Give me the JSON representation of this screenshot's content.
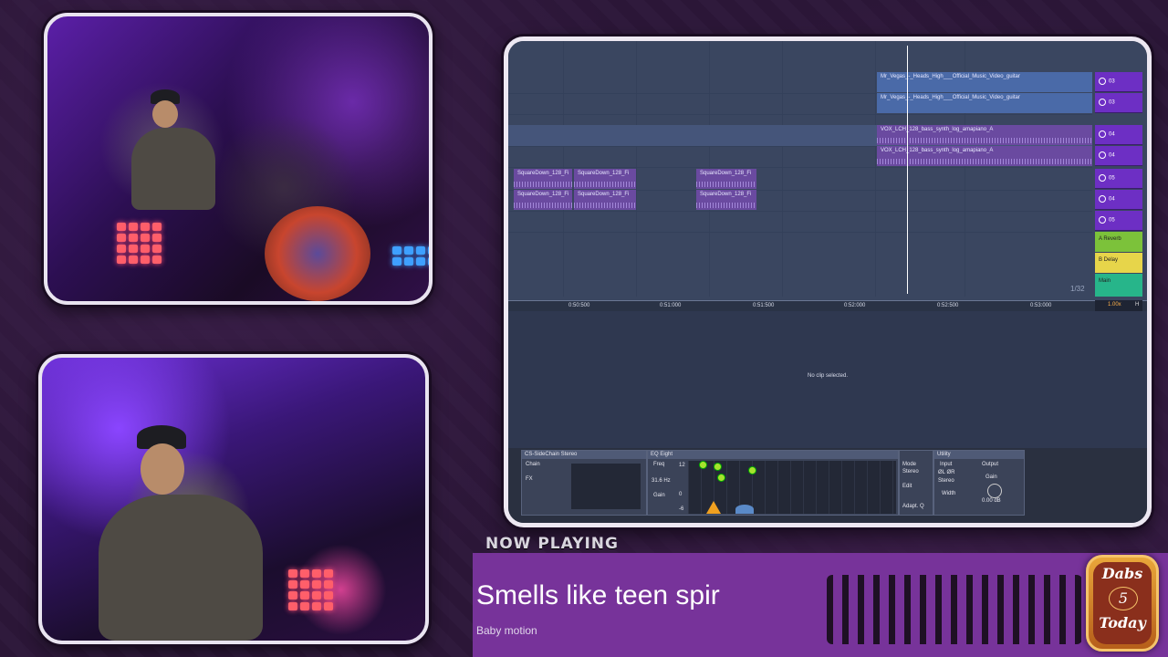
{
  "daw": {
    "clips": [
      "Mr_Vegas_-_Heads_High___Official_Music_Video_guitar",
      "Mr_Vegas_-_Heads_High___Official_Music_Video_guitar",
      "VOX_LCH_128_bass_synth_log_amapiano_A",
      "VOX_LCH_128_bass_synth_log_amapiano_A",
      "SquareDown_128_Fi",
      "SquareDown_128_Fi",
      "SquareDown_128_Fi",
      "SquareDown_128_Fi",
      "SquareDown_128_Fi",
      "SquareDown_128_Fi"
    ],
    "tracks": [
      "03",
      "03",
      "04",
      "04",
      "05",
      "04",
      "05"
    ],
    "returns": [
      "A Reverb",
      "B Delay",
      "Main"
    ],
    "timeline": [
      "0:50:500",
      "0:51:000",
      "0:51:500",
      "0:52:000",
      "0:52:500",
      "0:53:000"
    ],
    "counter": "1/32",
    "footer_value": "1.00x",
    "footer_letter": "H",
    "no_clip_text": "No clip selected.",
    "devices": {
      "sidechain": "CS-SideChain Stereo",
      "chain_label": "Chain",
      "fx_label": "FX",
      "eq_title": "EQ Eight",
      "freq_label": "Freq",
      "freq_value": "31.6 Hz",
      "gain_label": "Gain",
      "eq_scale": [
        "12",
        "0",
        "-6"
      ],
      "utility_title": "Utility",
      "mode_label": "Mode",
      "mode_value": "Stereo",
      "edit_label": "Edit",
      "adapt_label": "Adapt. Q",
      "input_label": "Input",
      "input_value": "ØL ØR",
      "input_mode": "Stereo",
      "width_label": "Width",
      "output_label": "Output",
      "output_gain_label": "Gain",
      "output_gain_value": "0.00 dB"
    }
  },
  "now_playing": {
    "label": "NOW PLAYING",
    "title": "Smells like teen spir",
    "artist": "Baby motion"
  },
  "badge": {
    "top": "Dabs",
    "number": "5",
    "bottom": "Today"
  },
  "colors": {
    "accent_purple": "#77339a",
    "track_purple": "#6d2fc4",
    "reverb_green": "#7cc23a",
    "delay_yellow": "#e7d54a",
    "main_teal": "#27b58a"
  }
}
